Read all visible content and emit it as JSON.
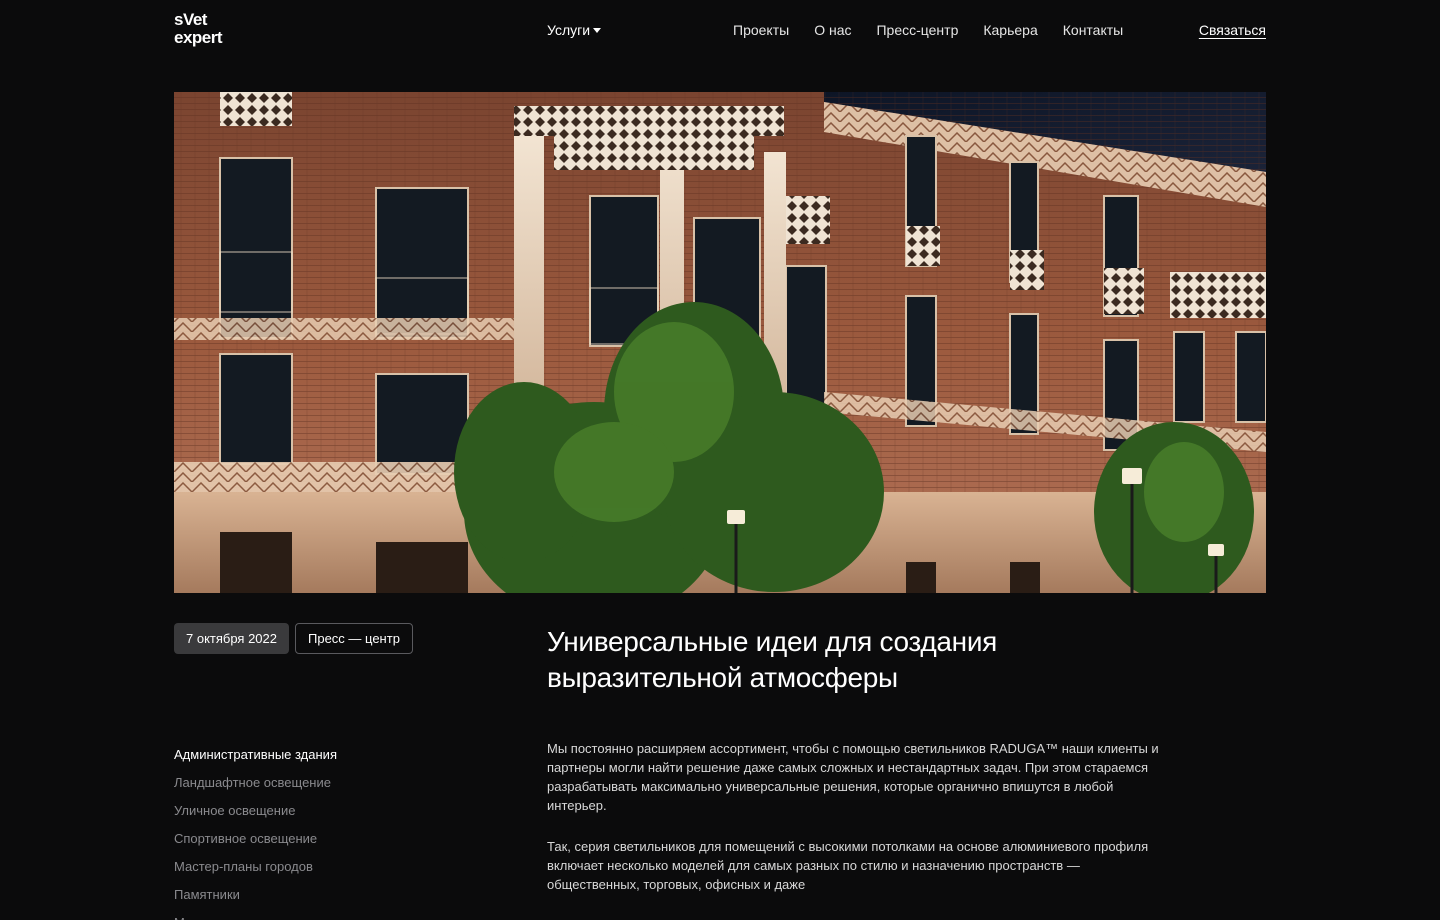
{
  "logo": {
    "line1": "sVet",
    "line2": "expert"
  },
  "nav": {
    "services_label": "Услуги",
    "items": [
      "Проекты",
      "О нас",
      "Пресс-центр",
      "Карьера",
      "Контакты"
    ],
    "contact_label": "Связаться"
  },
  "article": {
    "date": "7 октября 2022",
    "category": "Пресс — центр",
    "title": "Универсальные идеи для создания выразительной атмосферы",
    "paragraphs": [
      "Мы постоянно расширяем ассортимент, чтобы с помощью светильников RADUGA™ наши клиенты и партнеры могли найти решение даже самых сложных и нестандартных задач. При этом стараемся разрабатывать максимально универсальные решения, которые органично впишутся в любой интерьер.",
      "Так, серия светильников для помещений с высокими потолками на основе алюминиевого профиля включает несколько моделей для самых разных по стилю и назначению пространств — общественных, торговых, офисных и даже"
    ]
  },
  "sidebar": {
    "items": [
      "Административные здания",
      "Ландшафтное освещение",
      "Уличное освещение",
      "Спортивное освещение",
      "Мастер-планы городов",
      "Памятники",
      "Мосты"
    ],
    "active_index": 0
  },
  "colors": {
    "background": "#0b0b0c",
    "text": "#ffffff",
    "muted": "#8a8a8e",
    "chip": "#3a3a3c"
  }
}
